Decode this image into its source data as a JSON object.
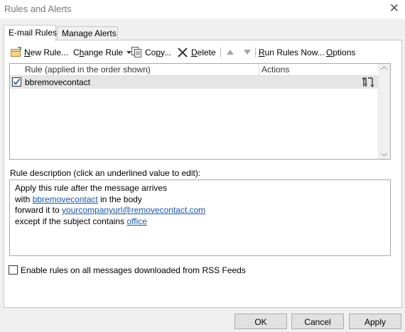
{
  "window": {
    "title": "Rules and Alerts",
    "close_glyph": "✕"
  },
  "tabs": [
    {
      "label": "E-mail Rules",
      "active": true
    },
    {
      "label": "Manage Alerts",
      "active": false
    }
  ],
  "toolbar": {
    "new_rule": {
      "pre": "",
      "u": "N",
      "post": "ew Rule...",
      "icon": "new-rule-icon"
    },
    "change_rule": {
      "pre": "C",
      "u": "h",
      "post": "ange Rule",
      "icon": "dropdown-arrow-icon"
    },
    "copy": {
      "pre": "Co",
      "u": "p",
      "post": "y...",
      "icon": "copy-icon"
    },
    "delete": {
      "pre": "",
      "u": "D",
      "post": "elete",
      "icon": "delete-x-icon"
    },
    "run_rules": {
      "pre": "",
      "u": "R",
      "post": "un Rules Now...",
      "icon": ""
    },
    "options": {
      "pre": "",
      "u": "O",
      "post": "ptions",
      "icon": ""
    }
  },
  "rules_list": {
    "col_rule": "Rule (applied in the order shown)",
    "col_actions": "Actions",
    "rows": [
      {
        "name": "bbremovecontact",
        "checked": true,
        "action_icon": "forward-rule-icon"
      }
    ]
  },
  "description": {
    "label": "Rule description (click an underlined value to edit):",
    "line1": "Apply this rule after the message arrives",
    "line2_pre": "with ",
    "line2_link": "bbremovecontact",
    "line2_post": " in the body",
    "line3_pre": "forward it to ",
    "line3_link": "yourcompanyurl@removecontact.com",
    "line4_pre": "except if the subject contains ",
    "line4_link": "office"
  },
  "rss": {
    "label": "Enable rules on all messages downloaded from RSS Feeds",
    "checked": false
  },
  "buttons": {
    "ok": "OK",
    "cancel": "Cancel",
    "apply": "Apply"
  },
  "colors": {
    "link": "#1a56a8",
    "selected_row": "#e5e5e5",
    "delete_x": "#333333"
  }
}
